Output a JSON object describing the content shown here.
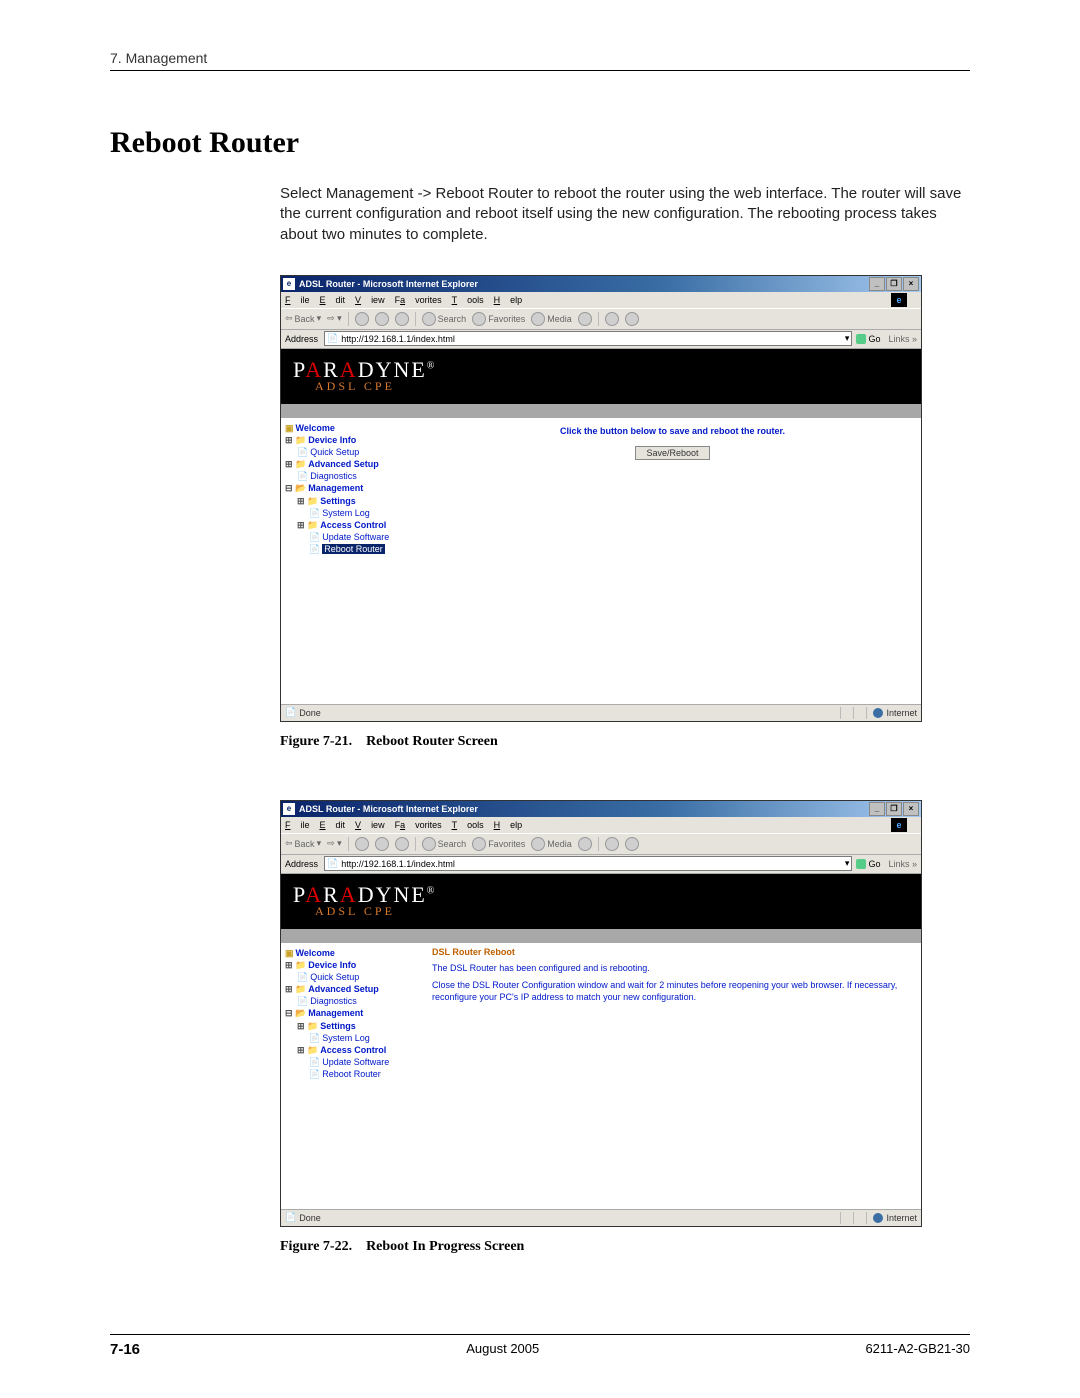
{
  "header": {
    "chapter": "7. Management"
  },
  "section": {
    "title": "Reboot Router"
  },
  "body": {
    "paragraph": "Select Management -> Reboot Router to reboot the router using the web interface. The router will save the current configuration and reboot itself using the new configuration. The rebooting process takes about two minutes to complete."
  },
  "captions": {
    "fig21": "Figure 7-21. Reboot Router Screen",
    "fig22": "Figure 7-22. Reboot In Progress Screen"
  },
  "footer": {
    "page": "7-16",
    "date": "August 2005",
    "doc": "6211-A2-GB21-30"
  },
  "ie": {
    "title": "ADSL Router - Microsoft Internet Explorer",
    "menu": {
      "file": "File",
      "edit": "Edit",
      "view": "View",
      "favorites": "Favorites",
      "tools": "Tools",
      "help": "Help"
    },
    "toolbar": {
      "back": "Back",
      "search": "Search",
      "favorites": "Favorites",
      "media": "Media"
    },
    "address_label": "Address",
    "address_value": "http://192.168.1.1/index.html",
    "go": "Go",
    "links": "Links »",
    "status_done": "Done",
    "status_zone": "Internet"
  },
  "branding": {
    "line1_a": "P",
    "line1_b": "A",
    "line1_c": "R",
    "line1_d": "A",
    "line1_e": "DYNE",
    "reg": "®",
    "line2": "ADSL CPE"
  },
  "tree": {
    "welcome": "Welcome",
    "device_info": "Device Info",
    "quick_setup": "Quick Setup",
    "advanced_setup": "Advanced Setup",
    "diagnostics": "Diagnostics",
    "management": "Management",
    "settings": "Settings",
    "system_log": "System Log",
    "access_control": "Access Control",
    "update_software": "Update Software",
    "reboot_router": "Reboot Router"
  },
  "screen1": {
    "instruction": "Click the button below to save and reboot the router.",
    "button": "Save/Reboot"
  },
  "screen2": {
    "heading": "DSL Router Reboot",
    "line1": "The DSL Router has been configured and is rebooting.",
    "line2": "Close the DSL Router Configuration window and wait for 2 minutes before reopening your web browser. If necessary, reconfigure your PC's IP address to match your new configuration."
  }
}
